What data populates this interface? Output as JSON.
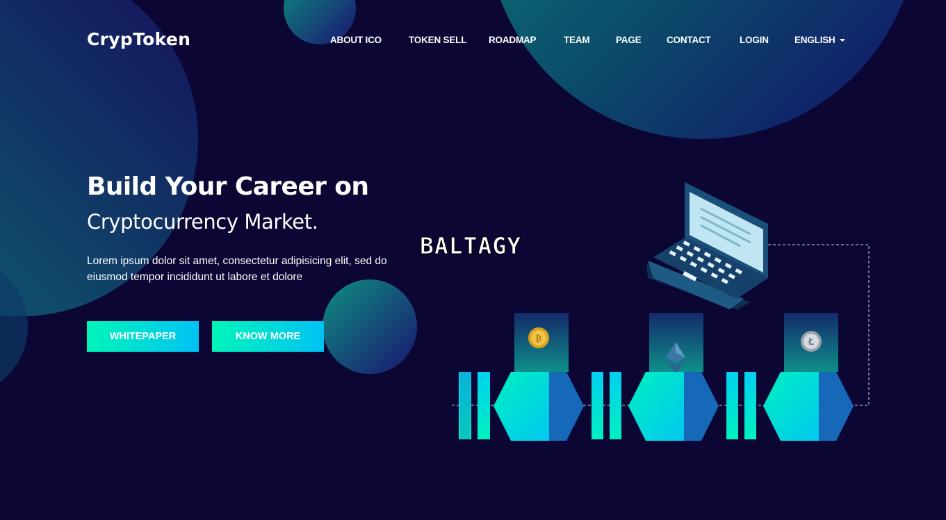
{
  "brand": {
    "logo_text": "CrypToken"
  },
  "nav": {
    "items": [
      {
        "label": "ABOUT ICO"
      },
      {
        "label": "TOKEN SELL"
      },
      {
        "label": "ROADMAP"
      },
      {
        "label": "TEAM"
      },
      {
        "label": "PAGE"
      },
      {
        "label": "CONTACT"
      },
      {
        "label": "LOGIN"
      },
      {
        "label": "ENGLISH"
      }
    ]
  },
  "hero": {
    "title": "Build Your Career on",
    "subtitle": "Cryptocurrency Market.",
    "text": "Lorem ipsum dolor sit amet, consectetur adipisicing elit, sed do eiusmod tempor incididunt ut labore et dolore",
    "buttons": {
      "whitepaper": "WHITEPAPER",
      "know_more": "KNOW MORE"
    }
  },
  "watermark": "BALTAGY",
  "illustration": {
    "coins": [
      "bitcoin-coin-icon",
      "ethereum-icon",
      "litecoin-coin-icon"
    ]
  },
  "colors": {
    "background": "#0b0633",
    "accent_start": "#00f5b8",
    "accent_end": "#00c2f5",
    "circle_teal": "#0f7a7a"
  }
}
